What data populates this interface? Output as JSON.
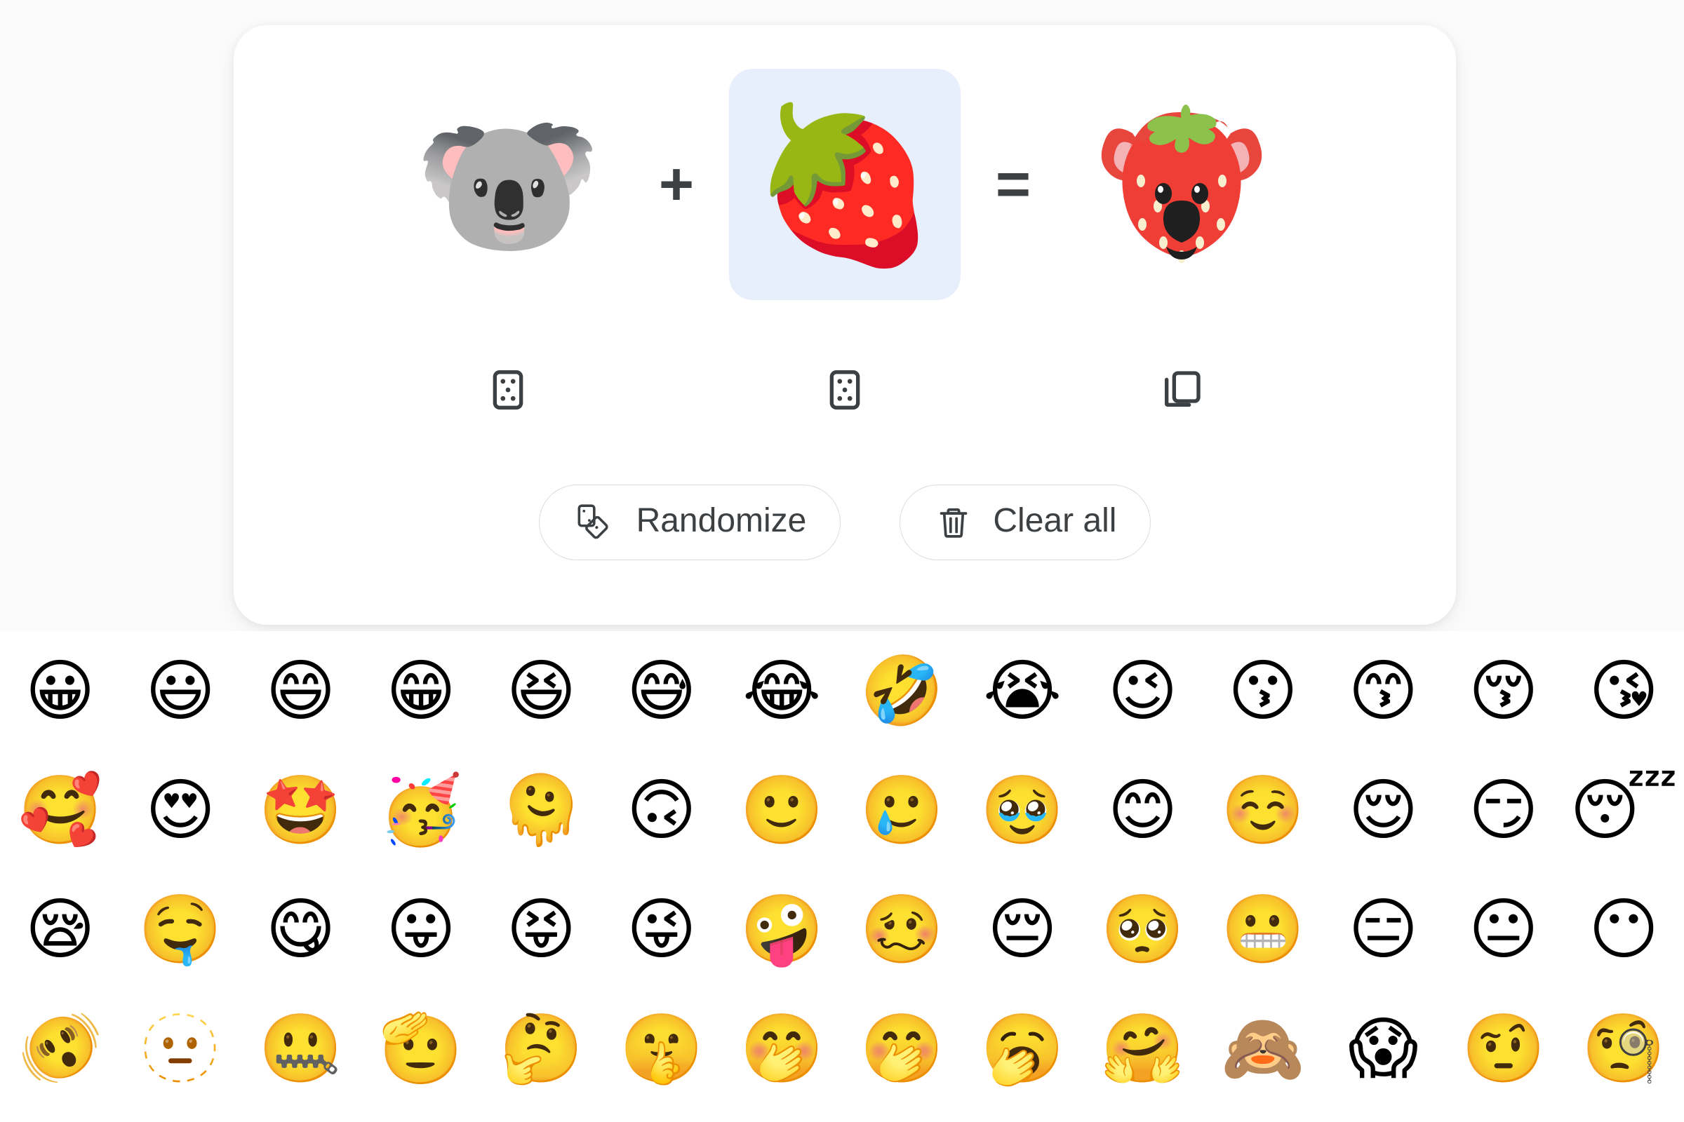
{
  "mixer": {
    "left_slot": {
      "emoji": "🐨",
      "name": "koala",
      "selected": false
    },
    "operator_plus": "+",
    "right_slot": {
      "emoji": "🍓",
      "name": "strawberry",
      "selected": true
    },
    "operator_equals": "=",
    "result_slot": {
      "emoji": "🍓",
      "name": "koala-strawberry-mashup"
    },
    "selected_highlight_color": "#e8effc",
    "icons": {
      "left_random": "dice-icon",
      "right_random": "dice-icon",
      "copy_result": "copy-icon"
    },
    "buttons": {
      "randomize": {
        "label": "Randomize",
        "icon": "two-dice-icon"
      },
      "clear_all": {
        "label": "Clear all",
        "icon": "trash-icon"
      }
    }
  },
  "picker": {
    "columns": 14,
    "emojis": [
      "😀",
      "😃",
      "😄",
      "😁",
      "😆",
      "😅",
      "😂",
      "🤣",
      "😭",
      "😉",
      "😗",
      "😙",
      "😚",
      "😘",
      "🥰",
      "😍",
      "🤩",
      "🥳",
      "🫠",
      "🙃",
      "🙂",
      "🥲",
      "🥹",
      "😊",
      "☺️",
      "😌",
      "😏",
      "😴",
      "😪",
      "🤤",
      "😋",
      "😛",
      "😝",
      "😜",
      "🤪",
      "🥴",
      "😔",
      "🥺",
      "😬",
      "😑",
      "😐",
      "😶",
      "🫨",
      "🫥",
      "🤐",
      "🫡",
      "🤔",
      "🤫",
      "🤭",
      "🤭",
      "🥱",
      "🤗",
      "🙈",
      "😱",
      "🤨",
      "🧐"
    ]
  },
  "colors": {
    "card_background": "#ffffff",
    "page_background": "#fbfbfb",
    "icon_stroke": "#3c4043",
    "button_border": "#dadce0",
    "text": "#3c4043"
  }
}
